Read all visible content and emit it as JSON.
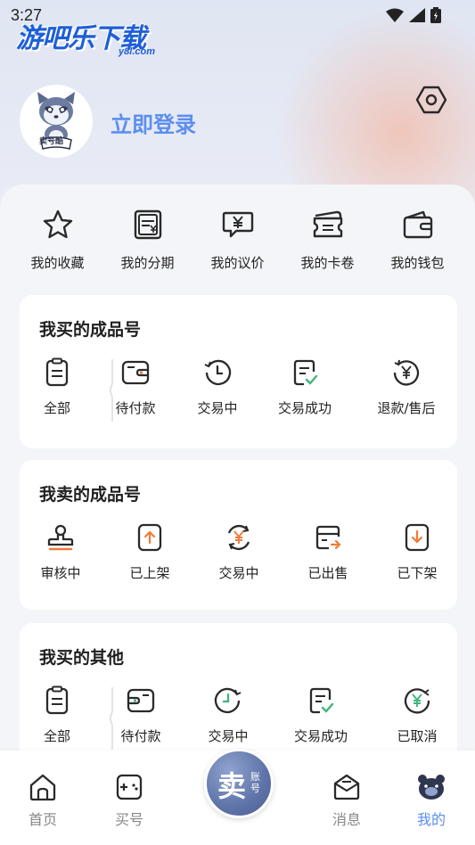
{
  "status_bar": {
    "time": "3:27"
  },
  "watermark": {
    "text": "游吧乐下载",
    "sub": "y8l.com"
  },
  "profile": {
    "login_label": "立即登录",
    "avatar_caption": "卖号酷"
  },
  "quick_actions": [
    {
      "label": "我的收藏",
      "icon": "star-icon"
    },
    {
      "label": "我的分期",
      "icon": "installment-icon"
    },
    {
      "label": "我的议价",
      "icon": "bargain-icon"
    },
    {
      "label": "我的卡卷",
      "icon": "coupon-icon"
    },
    {
      "label": "我的钱包",
      "icon": "wallet-icon"
    }
  ],
  "bought_accounts": {
    "title": "我买的成品号",
    "items": [
      {
        "label": "全部",
        "icon": "clipboard-icon"
      },
      {
        "label": "待付款",
        "icon": "wallet-pay-icon"
      },
      {
        "label": "交易中",
        "icon": "clock-icon"
      },
      {
        "label": "交易成功",
        "icon": "doc-check-icon"
      },
      {
        "label": "退款/售后",
        "icon": "refund-icon"
      }
    ]
  },
  "sold_accounts": {
    "title": "我卖的成品号",
    "items": [
      {
        "label": "审核中",
        "icon": "stamp-icon"
      },
      {
        "label": "已上架",
        "icon": "shelf-up-icon"
      },
      {
        "label": "交易中",
        "icon": "yen-cycle-icon"
      },
      {
        "label": "已出售",
        "icon": "sold-card-icon"
      },
      {
        "label": "已下架",
        "icon": "shelf-down-icon"
      }
    ]
  },
  "bought_other": {
    "title": "我买的其他",
    "items": [
      {
        "label": "全部",
        "icon": "clipboard-icon"
      },
      {
        "label": "待付款",
        "icon": "wallet-pay-icon"
      },
      {
        "label": "交易中",
        "icon": "clock-icon"
      },
      {
        "label": "交易成功",
        "icon": "doc-check-icon"
      },
      {
        "label": "已取消",
        "icon": "cancel-icon"
      }
    ]
  },
  "tabbar": {
    "items": [
      {
        "label": "首页",
        "icon": "home-icon"
      },
      {
        "label": "买号",
        "icon": "gamepad-icon"
      },
      {
        "label": "消息",
        "icon": "message-icon"
      },
      {
        "label": "我的",
        "icon": "profile-bear-icon"
      }
    ],
    "active": "我的",
    "sell_main": "卖",
    "sell_sub": "账号"
  },
  "colors": {
    "accent": "#5b8ef0",
    "orange": "#f07a3a",
    "green": "#3fb57a"
  }
}
